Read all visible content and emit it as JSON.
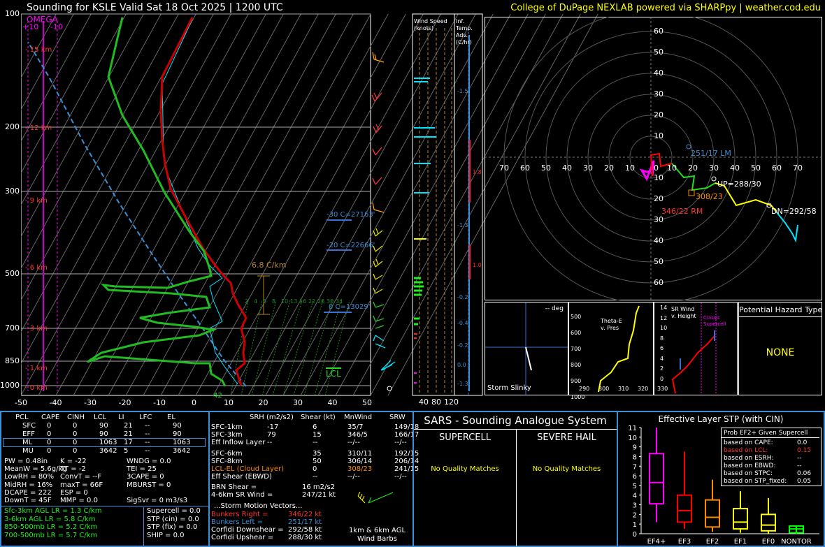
{
  "header": {
    "title": "Sounding for KSLE Valid  Sat 18 Oct 2025 | 1200 UTC",
    "credit": "College of DuPage NEXLAB powered via SHARPpy | weather.cod.edu"
  },
  "skewt": {
    "pressure_labels": [
      "100",
      "200",
      "300",
      "500",
      "700",
      "850",
      "1000"
    ],
    "temp_labels": [
      "-50",
      "-40",
      "-30",
      "-20",
      "-10",
      "0",
      "10",
      "20",
      "30",
      "40",
      "50"
    ],
    "height_labels": [
      "15 km",
      "12 km",
      "9 km",
      "6 km",
      "3 km",
      "1 km",
      "0 km"
    ],
    "omega_title": "OMEGA",
    "omega_ticks": [
      "+10",
      "-10"
    ],
    "lapse_label": "6.8 C/km",
    "isotherm_labels": [
      "-30 C=27163'",
      "-20 C=22666'",
      "0 C=13029'"
    ],
    "lcl_label": "LCL",
    "sfc_temp_label": "42",
    "mix_labels": [
      "2",
      "4",
      "6",
      "8",
      "10",
      "13",
      "16",
      "22",
      "26",
      "30",
      "34"
    ],
    "wind_speed_title": "Wind Speed (knots)",
    "wind_speed_ticks": [
      "40",
      "80",
      "120"
    ],
    "inf_temp_title": "Inf. Temp. Adv. (C/hr)",
    "inf_temp_values": [
      "-1.5",
      "-1.3",
      "-0.2",
      "-0.4",
      "-0.2",
      "0.0",
      "-1.3"
    ],
    "inf_temp_bars": [
      "1.8",
      "1.0"
    ]
  },
  "hodograph": {
    "rings_left": [
      "70",
      "60",
      "50",
      "40",
      "30",
      "20",
      "10"
    ],
    "rings_right": [
      "10",
      "20",
      "30",
      "40",
      "50",
      "60",
      "70"
    ],
    "rings_up": [
      "60",
      "50",
      "40",
      "30",
      "20",
      "10"
    ],
    "rings_down": [
      "10",
      "20",
      "30",
      "40",
      "50",
      "60"
    ],
    "center": "0",
    "lm_label": "251/17 LM",
    "rm_label": "346/22 RM",
    "mean_label": "308/23",
    "up_label": "UP=288/30",
    "dn_label": "DN=292/58"
  },
  "storm_slinky": {
    "title": "-- deg",
    "label": "Storm Slinky"
  },
  "theta_e": {
    "title": "Theta-E v. Pres",
    "ylabels": [
      "500",
      "600",
      "700",
      "800",
      "900",
      "1000"
    ],
    "xlabels": [
      "290",
      "300",
      "310",
      "320",
      "330"
    ]
  },
  "srwind": {
    "title": "SR Wind v. Height",
    "ylabels": [
      "14",
      "12",
      "10",
      "8",
      "6",
      "4",
      "2",
      "0"
    ],
    "xlabels": [
      "0",
      "20",
      "40",
      "60",
      "80"
    ],
    "classic": "Classic Supercell"
  },
  "hazard": {
    "title": "Potential Hazard Type",
    "value": "NONE"
  },
  "parcel_table": {
    "headers": [
      "PCL",
      "CAPE",
      "CINH",
      "LCL",
      "LI",
      "LFC",
      "EL"
    ],
    "rows": [
      [
        "SFC",
        "0",
        "0",
        "90",
        "21",
        "--",
        "90"
      ],
      [
        "EFF",
        "0",
        "0",
        "90",
        "21",
        "--",
        "90"
      ],
      [
        "ML",
        "0",
        "0",
        "1063",
        "17",
        "--",
        "1063"
      ],
      [
        "MU",
        "0",
        "0",
        "3642",
        "5",
        "--",
        "3642"
      ]
    ]
  },
  "indices": {
    "col1": [
      "PW = 0.48in",
      "MeanW = 5.6g/kg",
      "LowRH = 80%",
      "MidRH = 16%",
      "DCAPE = 222",
      "DownT = 45F"
    ],
    "col2": [
      "K = -22",
      "TT = -2",
      "ConvT = --F",
      "maxT = 66F",
      "ESP = 0",
      "MMP = 0.0"
    ],
    "col3": [
      "WNDG = 0.0",
      "TEI = 25",
      "3CAPE = 0",
      "MBURST = 0",
      "",
      ""
    ],
    "sigsvr": "SigSvr = 0 m3/s3"
  },
  "lapse": [
    "Sfc-3km AGL LR = 1.3 C/km",
    "3-6km AGL LR = 5.8 C/km",
    "850-500mb LR = 5.2 C/km",
    "700-500mb LR = 5.7 C/km"
  ],
  "composites": [
    "Supercell = 0.0",
    "STP (cin) = 0.0",
    "STP (fix) = 0.0",
    "SHIP = 0.0"
  ],
  "kinematics": {
    "headers": [
      "SRH (m2/s2)",
      "Shear (kt)",
      "MnWind",
      "SRW"
    ],
    "rows": [
      [
        "SFC-1km",
        "-17",
        "6",
        "35/7",
        "149/18"
      ],
      [
        "SFC-3km",
        "79",
        "15",
        "346/5",
        "166/17"
      ],
      [
        "Eff Inflow Layer",
        "--",
        "--",
        "--/--",
        "--/--"
      ],
      [
        "SFC-6km",
        "",
        "35",
        "310/11",
        "192/15"
      ],
      [
        "SFC-8km",
        "",
        "50",
        "306/14",
        "206/14"
      ],
      [
        "LCL-EL (Cloud Layer)",
        "",
        "0",
        "308/23",
        "241/15"
      ],
      [
        "Eff Shear (EBWD)",
        "",
        "--",
        "--/--",
        "--/--"
      ]
    ],
    "brn_shear": [
      "BRN Shear =",
      "16 m2/s2"
    ],
    "sr_wind": [
      "4-6km SR Wind =",
      "247/21 kt"
    ],
    "storm_motion_title": "...Storm Motion Vectors...",
    "motions": [
      [
        "Bunkers Right =",
        "346/22 kt"
      ],
      [
        "Bunkers Left =",
        "251/17 kt"
      ],
      [
        "Corfidi Downshear =",
        "292/58 kt"
      ],
      [
        "Corfidi Upshear =",
        "288/30 kt"
      ]
    ],
    "barbs_label": "1km & 6km AGL Wind Barbs"
  },
  "sars": {
    "title": "SARS - Sounding Analogue System",
    "supercell": "SUPERCELL",
    "hail": "SEVERE HAIL",
    "no_match_1": "No Quality Matches",
    "no_match_2": "No Quality Matches"
  },
  "stp_box": {
    "title": "Effective Layer STP (with CIN)",
    "legend_title": "Prob EF2+ Given Supercell",
    "legend": [
      [
        "based on CAPE:",
        "0.0"
      ],
      [
        "based on LCL:",
        "0.15"
      ],
      [
        "based on ESRH:",
        "--"
      ],
      [
        "based on EBWD:",
        "--"
      ],
      [
        "based on STPC:",
        "0.06"
      ],
      [
        "based on STP_fixed:",
        "0.05"
      ]
    ],
    "yticks": [
      "0",
      "1",
      "2",
      "3",
      "4",
      "5",
      "6",
      "7",
      "8",
      "9",
      "10",
      "11"
    ],
    "categories": [
      "EF4+",
      "EF3",
      "EF2",
      "EF1",
      "EF0",
      "NONTOR"
    ]
  },
  "chart_data": [
    {
      "type": "line",
      "title": "Sounding for KSLE Valid  Sat 18 Oct 2025 | 1200 UTC",
      "xlabel": "",
      "ylabel": "",
      "x_ticks": [
        -50,
        -40,
        -30,
        -20,
        -10,
        0,
        10,
        20,
        30,
        40,
        50
      ],
      "y_ticks": [
        100,
        200,
        300,
        500,
        700,
        850,
        1000
      ],
      "y_scale": "log (pressure, mb)",
      "series": []
    },
    {
      "type": "line",
      "title": "",
      "xlim": [
        -70,
        70
      ],
      "ylim": [
        -60,
        60
      ],
      "series": [],
      "annotations": [
        "251/17 LM",
        "346/22 RM",
        "308/23",
        "UP=288/30",
        "DN=292/58"
      ]
    },
    {
      "type": "box",
      "title": "Effective Layer STP (with CIN)",
      "categories": [
        "EF4+",
        "EF3",
        "EF2",
        "EF1",
        "EF0",
        "NONTOR"
      ],
      "ylim": [
        0,
        11
      ],
      "colors": [
        "#ff00ff",
        "#ff0000",
        "#ff8c00",
        "#ffff00",
        "#ffff00",
        "#00ff00"
      ],
      "whisker_low": [
        1.2,
        0.5,
        0.2,
        0.1,
        0.0,
        0.0
      ],
      "q1": [
        3.1,
        1.2,
        0.7,
        0.5,
        0.3,
        0.1
      ],
      "median": [
        5.3,
        2.4,
        1.7,
        1.2,
        0.9,
        0.5
      ],
      "q3": [
        8.3,
        4.0,
        3.5,
        2.6,
        2.0,
        0.8
      ],
      "whisker_high": [
        11.0,
        8.5,
        5.6,
        4.4,
        3.7,
        0.0
      ]
    }
  ]
}
